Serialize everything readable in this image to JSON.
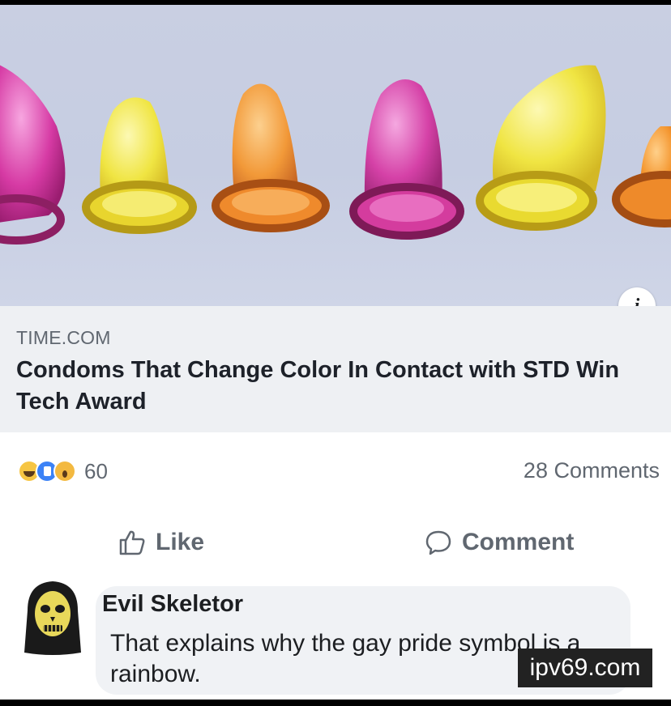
{
  "post": {
    "link_preview": {
      "source": "TIME.COM",
      "headline": "Condoms That Change Color In Contact with STD Win Tech Award",
      "image_icon": "condoms-image",
      "info_icon": "info-icon"
    },
    "stats": {
      "reaction_icons": [
        "haha-reaction-icon",
        "like-reaction-icon",
        "wow-reaction-icon"
      ],
      "reactions_count": "60",
      "comments_count": "28 Comments"
    },
    "actions": {
      "like_label": "Like",
      "comment_label": "Comment"
    },
    "comment": {
      "author": "Evil Skeletor",
      "text": "That explains why the gay pride symbol is a rainbow.",
      "avatar_icon": "skeletor-avatar"
    }
  },
  "watermark": "ipv69.com",
  "colors": {
    "image_background": "#c9cfe2",
    "link_box": "#eef0f3",
    "muted_text": "#606770",
    "comment_bubble": "#f0f2f5"
  }
}
